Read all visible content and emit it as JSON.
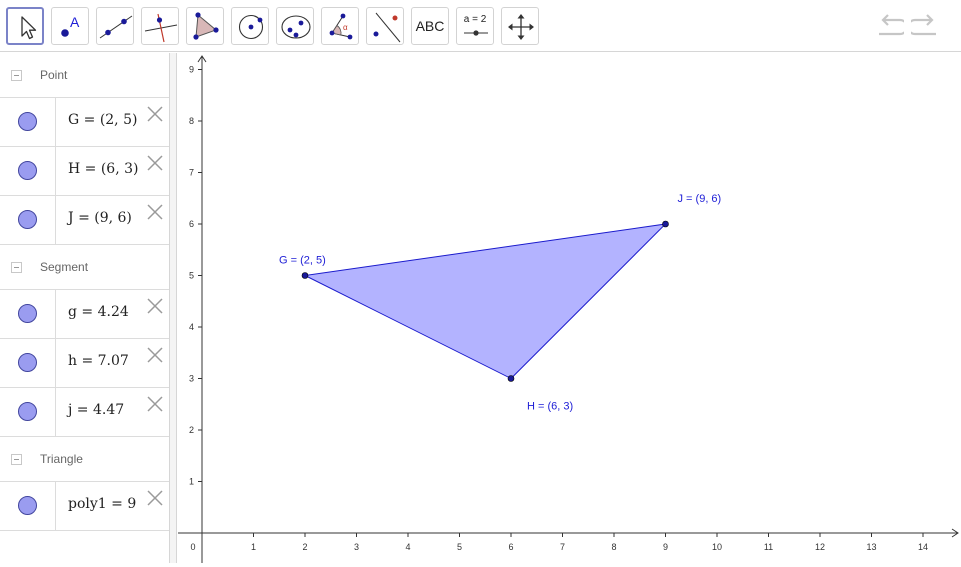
{
  "toolbar": {
    "tools": [
      {
        "name": "move-tool",
        "icon": "cursor-arrow-icon",
        "selected": true
      },
      {
        "name": "point-tool",
        "icon": "point-icon"
      },
      {
        "name": "line-tool",
        "icon": "line-through-points-icon"
      },
      {
        "name": "perpendicular-tool",
        "icon": "perpendicular-line-icon"
      },
      {
        "name": "polygon-tool",
        "icon": "polygon-icon"
      },
      {
        "name": "circle-tool",
        "icon": "circle-center-point-icon"
      },
      {
        "name": "conic-tool",
        "icon": "ellipse-icon"
      },
      {
        "name": "angle-tool",
        "icon": "angle-icon"
      },
      {
        "name": "reflect-tool",
        "icon": "reflect-about-line-icon"
      },
      {
        "name": "text-tool",
        "icon": "text-icon",
        "label": "ABC"
      },
      {
        "name": "slider-tool",
        "icon": "slider-icon",
        "label": "a = 2"
      },
      {
        "name": "move-graphics-tool",
        "icon": "move-arrows-icon"
      }
    ],
    "undo_icon": "undo-icon",
    "redo_icon": "redo-icon"
  },
  "algebra": {
    "groups": [
      {
        "label": "Point",
        "items": [
          {
            "expr": "G = (2, 5)"
          },
          {
            "expr": "H = (6, 3)"
          },
          {
            "expr": "J = (9, 6)"
          }
        ]
      },
      {
        "label": "Segment",
        "items": [
          {
            "expr": "g = 4.24"
          },
          {
            "expr": "h = 7.07"
          },
          {
            "expr": "j = 4.47"
          }
        ]
      },
      {
        "label": "Triangle",
        "items": [
          {
            "expr": "poly1 = 9"
          }
        ]
      }
    ]
  },
  "graphics": {
    "x_ticks": [
      "0",
      "1",
      "2",
      "3",
      "4",
      "5",
      "6",
      "7",
      "8",
      "9",
      "10",
      "11",
      "12",
      "13",
      "14"
    ],
    "y_ticks": [
      "1",
      "2",
      "3",
      "4",
      "5",
      "6",
      "7",
      "8",
      "9"
    ],
    "points": [
      {
        "name": "G",
        "x": 2,
        "y": 5,
        "label": "G = (2, 5)"
      },
      {
        "name": "H",
        "x": 6,
        "y": 3,
        "label": "H = (6, 3)"
      },
      {
        "name": "J",
        "x": 9,
        "y": 6,
        "label": "J = (9, 6)"
      }
    ],
    "colors": {
      "polygon_fill": "#b3b3ff",
      "polygon_stroke": "#1a1acc",
      "point": "#1a1a99",
      "label": "#1d1dd6"
    }
  }
}
